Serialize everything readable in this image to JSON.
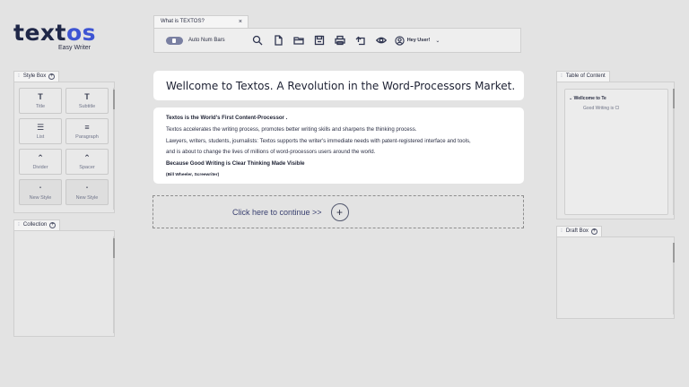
{
  "logo": {
    "part1": "text",
    "part2": "os",
    "subtitle": "Easy Writer"
  },
  "toolbar": {
    "tab_title": "What is TEXTOS?",
    "tab_close": "×",
    "toggle_label": "Auto Num Bars",
    "toggle_on": true,
    "icons": [
      "search-icon",
      "new-file-icon",
      "folder-icon",
      "save-icon",
      "print-icon",
      "export-icon",
      "preview-icon"
    ],
    "user_label": "Hey User!",
    "user_caret": "⌄"
  },
  "style_box": {
    "title": "Style Box",
    "plus": "+",
    "tiles": [
      {
        "icon": "T",
        "label": "Title"
      },
      {
        "icon": "T",
        "label": "Subtitle"
      },
      {
        "icon": "☰",
        "label": "List"
      },
      {
        "icon": "≡",
        "label": "Paragraph"
      },
      {
        "icon": "⌃",
        "label": "Divider"
      },
      {
        "icon": "⌃",
        "label": "Spacer"
      },
      {
        "icon": "•",
        "label": "New Style"
      },
      {
        "icon": "•",
        "label": "New Style"
      }
    ]
  },
  "collection": {
    "title": "Collection",
    "plus": "+"
  },
  "main": {
    "headline": "Wellcome to Textos. A Revolution in the Word-Processors Market.",
    "body": {
      "line1": "Textos is the World's First Content-Processor .",
      "line2": "Textos accelerates the writing  process, promotes better writing skills and sharpens the thinking  process.",
      "line3": "Lawyers, writers, students, journalists: Textos supports the writer's immediate needs with patent-registered interface and tools,",
      "line4": "and is about to change the lives of millions of word-processors users around the world.",
      "line5": "Because Good Writing is Clear Thinking Made Visible",
      "line6": "(Bill Wheeler, Screewriter)"
    },
    "continue_label": "Click here to continue >>",
    "continue_plus": "+"
  },
  "toc": {
    "title": "Table of Content",
    "items": [
      {
        "caret": "⌄",
        "label": "Wellcome to Te"
      },
      {
        "label": "Good Writing is Cl"
      }
    ]
  },
  "draft_box": {
    "title": "Draft Box",
    "plus": "+"
  },
  "colors": {
    "background": "#e3e3e3",
    "accent": "#3e55d3",
    "logo_dark": "#1f2748",
    "toggle": "#7a80a2"
  }
}
